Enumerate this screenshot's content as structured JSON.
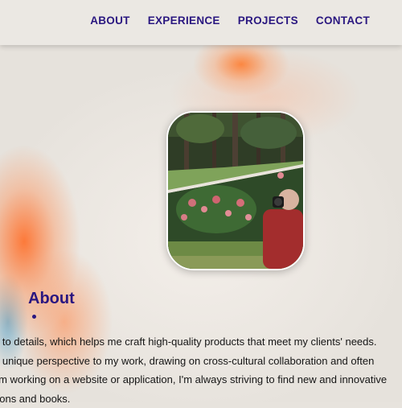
{
  "nav": {
    "items": [
      {
        "label": "ABOUT"
      },
      {
        "label": "EXPERIENCE"
      },
      {
        "label": "PROJECTS"
      },
      {
        "label": "CONTACT"
      }
    ]
  },
  "portrait": {
    "description_icon": "profile-photo"
  },
  "about": {
    "title": "About",
    "lines": [
      "e to details, which helps me craft high-quality products that meet my clients' needs.",
      "a unique perspective to my work, drawing on cross-cultural collaboration and often",
      "I'm working on a website or application, I'm always striving to find new and innovative",
      "dons and books."
    ]
  },
  "colors": {
    "accent": "#2a1780",
    "background": "#e6e2dc",
    "nav_background": "#ebe8e3",
    "splash_orange": "#ff7a2e"
  }
}
